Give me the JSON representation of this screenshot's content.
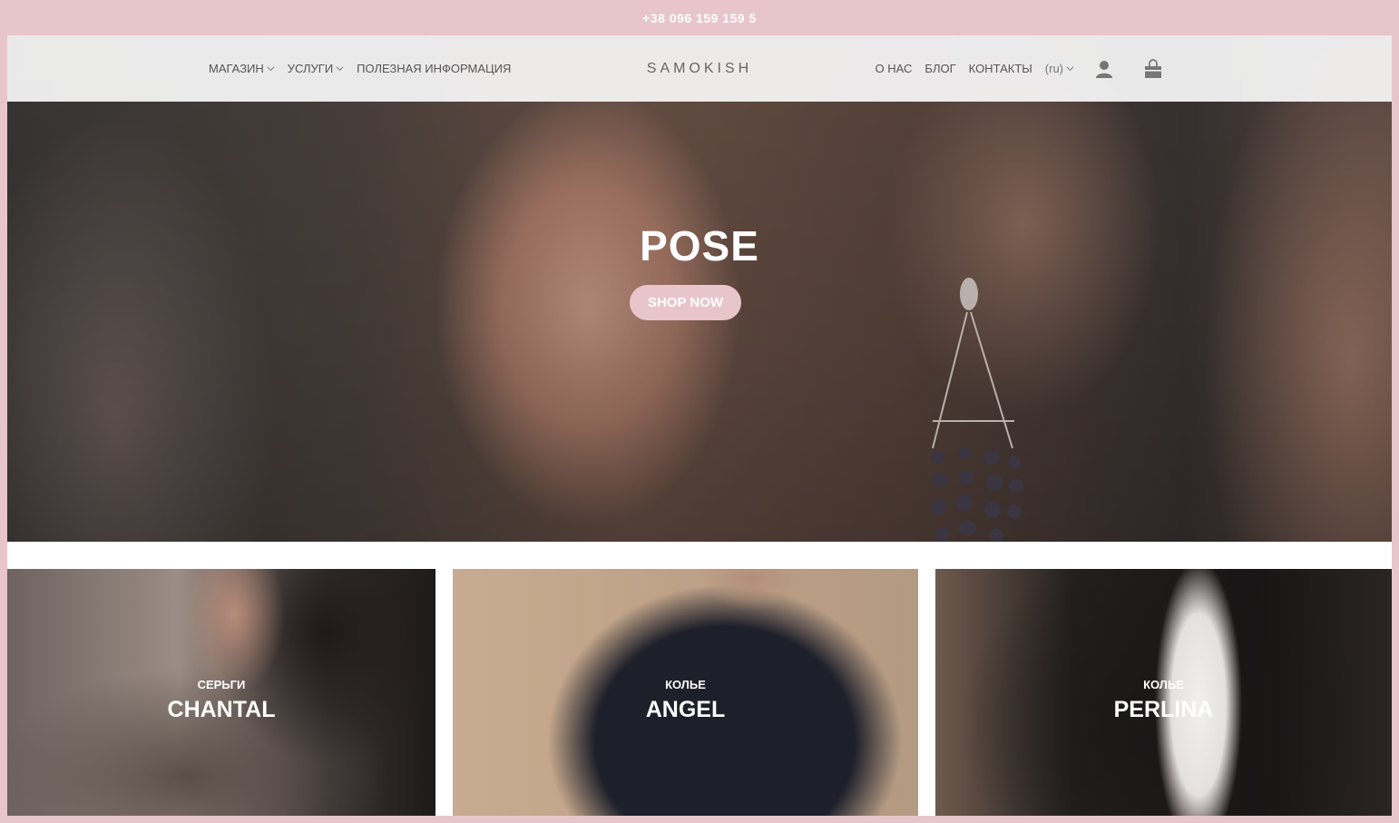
{
  "topbar": {
    "phone": "+38 096 159 159 5"
  },
  "header": {
    "nav_left": [
      {
        "label": "МАГАЗИН",
        "has_dropdown": true
      },
      {
        "label": "УСЛУГИ",
        "has_dropdown": true
      },
      {
        "label": "ПОЛЕЗНАЯ ИНФОРМАЦИЯ",
        "has_dropdown": false
      }
    ],
    "logo": "SAMOKISH",
    "nav_right": [
      {
        "label": "О НАС"
      },
      {
        "label": "БЛОГ"
      },
      {
        "label": "КОНТАКТЫ"
      }
    ],
    "language": "(ru)",
    "icons": [
      "user-icon",
      "shopping-bag-icon"
    ]
  },
  "hero": {
    "title": "POSE",
    "button_label": "SHOP NOW"
  },
  "cards": [
    {
      "category": "СЕРЬГИ",
      "title": "CHANTAL"
    },
    {
      "category": "КОЛЬЕ",
      "title": "ANGEL"
    },
    {
      "category": "КОЛЬЕ",
      "title": "PERLINA"
    }
  ],
  "colors": {
    "accent_pink": "#e8c5ca",
    "header_bg": "#f7f7f7",
    "nav_text": "#555555"
  }
}
